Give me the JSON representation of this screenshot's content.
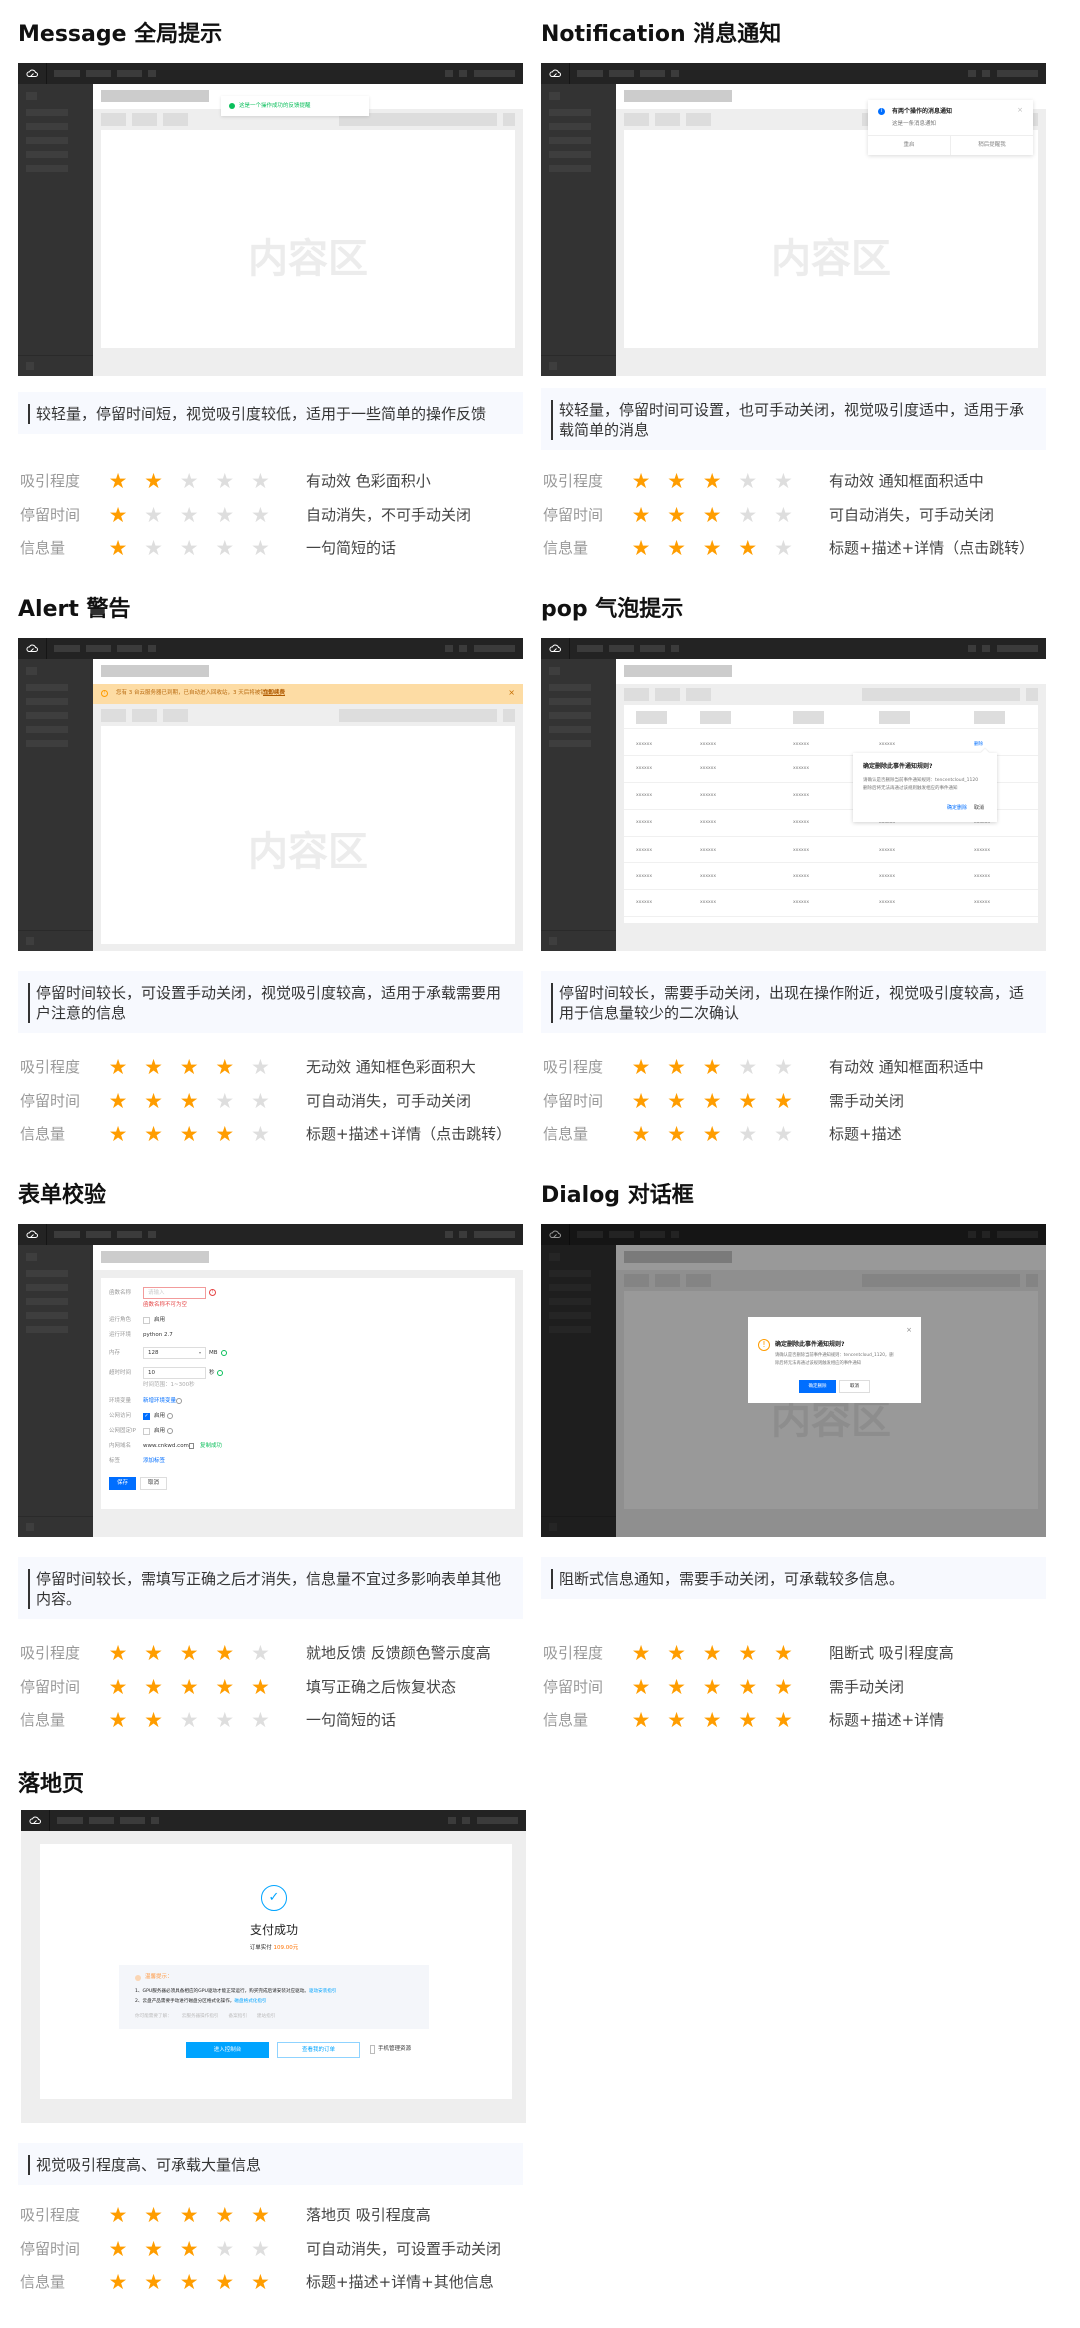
{
  "content_placeholder": "内容区",
  "sections": {
    "message": {
      "title": "Message 全局提示",
      "toast_text": "这是一个操作成功的反馈提醒",
      "description": "较轻量，停留时间短，视觉吸引度较低，适用于一些简单的操作反馈",
      "ratings": [
        {
          "label": "吸引程度",
          "stars": 2,
          "note": "有动效  色彩面积小"
        },
        {
          "label": "停留时间",
          "stars": 1,
          "note": "自动消失，不可手动关闭"
        },
        {
          "label": "信息量",
          "stars": 1,
          "note": "一句简短的话"
        }
      ]
    },
    "notification": {
      "title": "Notification 消息通知",
      "notice_title": "有两个操作的消息通知",
      "notice_desc": "这是一条消息通知",
      "btn_restart": "重启",
      "btn_later": "稍后提醒我",
      "description": "较轻量，停留时间可设置，也可手动关闭，视觉吸引度适中，适用于承载简单的消息",
      "ratings": [
        {
          "label": "吸引程度",
          "stars": 3,
          "note": "有动效  通知框面积适中"
        },
        {
          "label": "停留时间",
          "stars": 3,
          "note": "可自动消失，可手动关闭"
        },
        {
          "label": "信息量",
          "stars": 4,
          "note": "标题+描述+详情（点击跳转）"
        }
      ]
    },
    "alert": {
      "title": "Alert 警告",
      "alert_text": "您有 3 台云服务器已到期，已自动进入回收站，3 天后将被销毁。",
      "alert_link": "立即续费",
      "description": "停留时间较长，可设置手动关闭，视觉吸引度较高，适用于承载需要用户注意的信息",
      "ratings": [
        {
          "label": "吸引程度",
          "stars": 4,
          "note": "无动效  通知框色彩面积大"
        },
        {
          "label": "停留时间",
          "stars": 3,
          "note": "可自动消失，可手动关闭"
        },
        {
          "label": "信息量",
          "stars": 4,
          "note": "标题+描述+详情（点击跳转）"
        }
      ]
    },
    "pop": {
      "title": "pop 气泡提示",
      "cell_text": "xxxxxx",
      "action_link": "删除",
      "pop_title": "确定删除此事件通知规则?",
      "pop_line1": "请确认是否删除当前事件通知规则：tencentcloud_1120",
      "pop_line2": "删除后将无法再通过该规则触发相应的事件通知",
      "btn_confirm": "确定删除",
      "btn_cancel": "取消",
      "description": "停留时间较长，需要手动关闭，出现在操作附近，视觉吸引度较高，适用于信息量较少的二次确认",
      "ratings": [
        {
          "label": "吸引程度",
          "stars": 3,
          "note": "有动效  通知框面积适中"
        },
        {
          "label": "停留时间",
          "stars": 5,
          "note": "需手动关闭"
        },
        {
          "label": "信息量",
          "stars": 3,
          "note": "标题+描述"
        }
      ]
    },
    "form": {
      "title": "表单校验",
      "labels": [
        "函数名称",
        "运行角色",
        "运行环境",
        "内存",
        "超时时间",
        "环境变量",
        "公网访问",
        "公网固定IP",
        "内网域名",
        "标签"
      ],
      "name_placeholder": "请输入",
      "name_error": "函数名称不可为空",
      "enable": "启用",
      "runtime": "python 2.7",
      "memory": "128",
      "memory_unit": "MB",
      "timeout": "10",
      "timeout_unit": "秒",
      "timeout_hint": "时间范围：1~300秒",
      "add_env": "新增环境变量",
      "domain": "www.cnkwd.com",
      "copied": "复制成功",
      "add_tag": "添加标签",
      "btn_save": "保存",
      "btn_cancel": "取消",
      "description": "停留时间较长，需填写正确之后才消失，信息量不宜过多影响表单其他内容。",
      "ratings": [
        {
          "label": "吸引程度",
          "stars": 4,
          "note": "就地反馈  反馈颜色警示度高"
        },
        {
          "label": "停留时间",
          "stars": 5,
          "note": "填写正确之后恢复状态"
        },
        {
          "label": "信息量",
          "stars": 2,
          "note": "一句简短的话"
        }
      ]
    },
    "dialog": {
      "title": "Dialog 对话框",
      "dialog_title": "确定删除此事件通知规则?",
      "dialog_line1": "请确认是否删除当前事件通知规则：tencentcloud_1120，删",
      "dialog_line2": "除后将无法再通过该规则触发相应的事件通知",
      "btn_confirm": "确定删除",
      "btn_cancel": "取消",
      "description": "阻断式信息通知，需要手动关闭，可承载较多信息。",
      "ratings": [
        {
          "label": "吸引程度",
          "stars": 5,
          "note": "阻断式  吸引程度高"
        },
        {
          "label": "停留时间",
          "stars": 5,
          "note": "需手动关闭"
        },
        {
          "label": "信息量",
          "stars": 5,
          "note": "标题+描述+详情"
        }
      ]
    },
    "landing": {
      "title": "落地页",
      "success_title": "支付成功",
      "order_label": "订单实付",
      "order_amount": "109.00元",
      "tips_title": "温馨提示：",
      "tip1": "1、GPU服务器必须具备相应的GPU驱动才能正常运行，购买完成后请安装对应驱动。",
      "tip1_link": "驱动安装指引",
      "tip2": "2、云盘产品需要手动进行磁盘分区格式化操作，",
      "tip2_link": "磁盘格式化指引",
      "more_label": "你可能需要了解：",
      "more_links": [
        "云服务器操作指引",
        "备案指引",
        "建站指引"
      ],
      "btn_console": "进入控制台",
      "btn_orders": "查看我的订单",
      "mobile_manage": "手机管理资源",
      "description": "视觉吸引程度高、可承载大量信息",
      "ratings": [
        {
          "label": "吸引程度",
          "stars": 5,
          "note": "落地页  吸引程度高"
        },
        {
          "label": "停留时间",
          "stars": 3,
          "note": "可自动消失，可设置手动关闭"
        },
        {
          "label": "信息量",
          "stars": 5,
          "note": "标题+描述+详情+其他信息"
        }
      ]
    }
  },
  "colors": {
    "star_on": "#ff9d00",
    "star_off": "#dedede",
    "primary": "#006eff",
    "success": "#0abf5b",
    "error": "#e54545",
    "warning_bg": "#fddca4",
    "landing_blue": "#00a4ff"
  }
}
